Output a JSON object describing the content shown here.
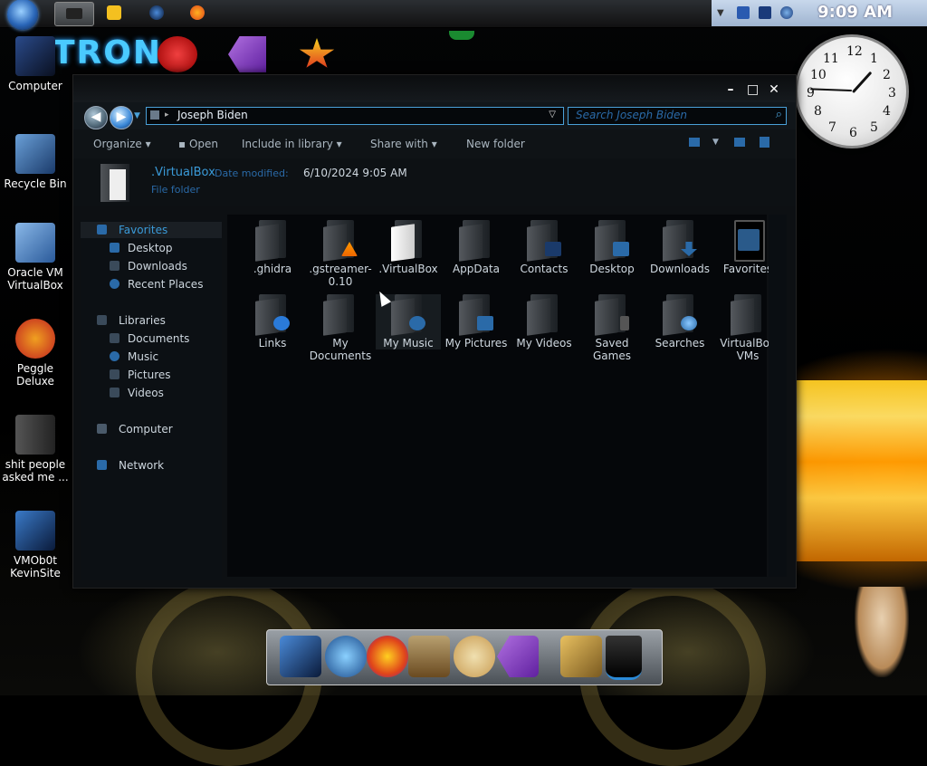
{
  "taskbar": {
    "clock": "9:09 AM"
  },
  "desktop": {
    "icons": [
      {
        "label": "Computer"
      },
      {
        "label": "Recycle Bin"
      },
      {
        "label": "Oracle VM VirtualBox"
      },
      {
        "label": "Peggle Deluxe"
      },
      {
        "label": "shit people asked me ..."
      },
      {
        "label": "VMOb0t KevinSite"
      }
    ]
  },
  "window": {
    "address": "Joseph Biden",
    "search_placeholder": "Search Joseph Biden",
    "commands": {
      "organize": "Organize",
      "open": "Open",
      "include": "Include in library",
      "share": "Share with",
      "new_folder": "New folder"
    },
    "details": {
      "name": ".VirtualBox",
      "date_label": "Date modified:",
      "date_value": "6/10/2024 9:05 AM",
      "type": "File folder"
    },
    "sidebar": {
      "favorites": "Favorites",
      "desktop": "Desktop",
      "downloads": "Downloads",
      "recent": "Recent Places",
      "libraries": "Libraries",
      "documents": "Documents",
      "music": "Music",
      "pictures": "Pictures",
      "videos": "Videos",
      "computer": "Computer",
      "network": "Network"
    },
    "files": [
      {
        "label": ".ghidra"
      },
      {
        "label": ".gstreamer-0.10"
      },
      {
        "label": ".VirtualBox"
      },
      {
        "label": "AppData"
      },
      {
        "label": "Contacts"
      },
      {
        "label": "Desktop"
      },
      {
        "label": "Downloads"
      },
      {
        "label": "Favorites"
      },
      {
        "label": "Links"
      },
      {
        "label": "My Documents"
      },
      {
        "label": "My Music"
      },
      {
        "label": "My Pictures"
      },
      {
        "label": "My Videos"
      },
      {
        "label": "Saved Games"
      },
      {
        "label": "Searches"
      },
      {
        "label": "VirtualBox VMs"
      }
    ]
  },
  "clock_gadget": {
    "numbers": [
      "12",
      "1",
      "2",
      "3",
      "4",
      "5",
      "6",
      "7",
      "8",
      "9",
      "10",
      "11"
    ]
  },
  "colors": {
    "accent": "#4aa0d8",
    "link": "#3a9ad8"
  }
}
